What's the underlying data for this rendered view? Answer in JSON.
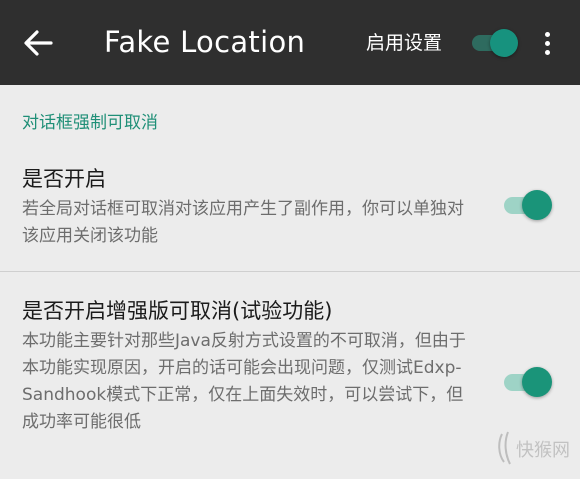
{
  "toolbar": {
    "title": "Fake Location",
    "enable_label": "启用设置",
    "enable_switch_on": true,
    "back_icon": "arrow-back-icon",
    "menu_icon": "more-vert-icon",
    "background_color": "#2f2f2f",
    "accent_color": "#17927e"
  },
  "category": {
    "title": "对话框强制可取消"
  },
  "preferences": [
    {
      "title": "是否开启",
      "summary": "若全局对话框可取消对该应用产生了副作用，你可以单独对该应用关闭该功能",
      "switch_on": true
    },
    {
      "title": "是否开启增强版可取消(试验功能)",
      "summary": "本功能主要针对那些Java反射方式设置的不可取消，但由于本功能实现原因，开启的话可能会出现问题，仅测试Edxp-Sandhook模式下正常，仅在上面失效时，可以尝试下，但成功率可能很低",
      "switch_on": true
    }
  ],
  "watermark": {
    "text": "快猴网"
  }
}
